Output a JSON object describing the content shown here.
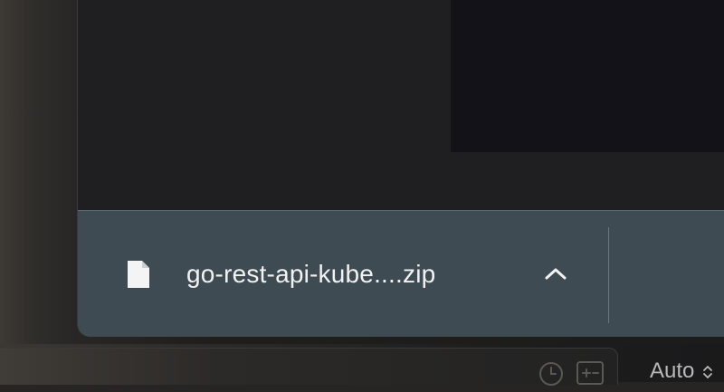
{
  "download_shelf": {
    "items": [
      {
        "file_name": "go-rest-api-kube....zip",
        "icon": "file-icon",
        "menu_icon": "chevron-up-icon"
      }
    ]
  },
  "bottom_toolbar": {
    "icons": [
      "history-icon",
      "diff-icon"
    ],
    "select_value": "Auto",
    "select_icon": "chevron-updown-icon"
  },
  "colors": {
    "shelf_background": "#3e4b53",
    "window_background": "#1f1f21",
    "dark_panel": "#121218"
  }
}
